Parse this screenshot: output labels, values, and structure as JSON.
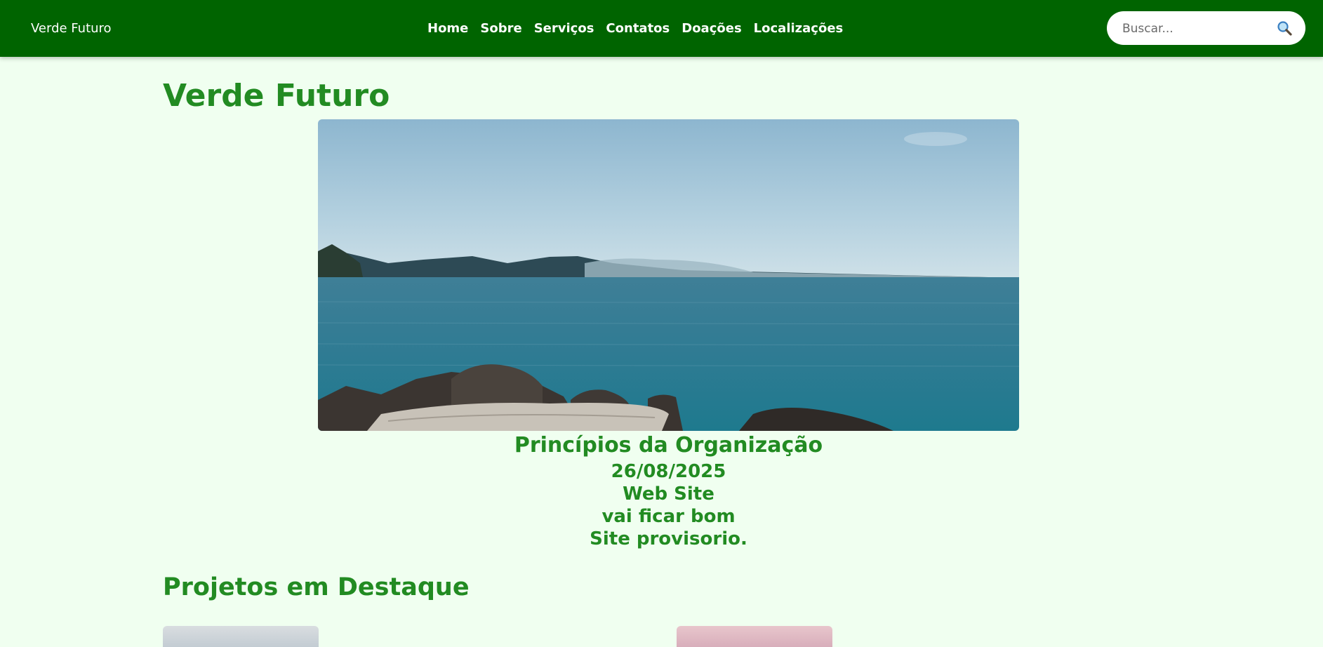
{
  "navbar": {
    "brand": "Verde Futuro",
    "links": [
      "Home",
      "Sobre",
      "Serviços",
      "Contatos",
      "Doações",
      "Localizações"
    ],
    "search_placeholder": "Buscar...",
    "colors": {
      "background": "#006400",
      "text": "#ffffff"
    }
  },
  "main": {
    "title": "Verde Futuro",
    "hero_image": "lake-coastline-photo",
    "principles": {
      "heading": "Princípios da Organização",
      "lines": [
        "26/08/2025",
        "Web Site",
        "vai ficar bom",
        "Site provisorio."
      ]
    },
    "projects": {
      "heading": "Projetos em Destaque",
      "items": [
        "project-image-1",
        "project-image-2"
      ]
    }
  },
  "colors": {
    "page_background": "#f0fff0",
    "heading_green": "#228b22"
  }
}
